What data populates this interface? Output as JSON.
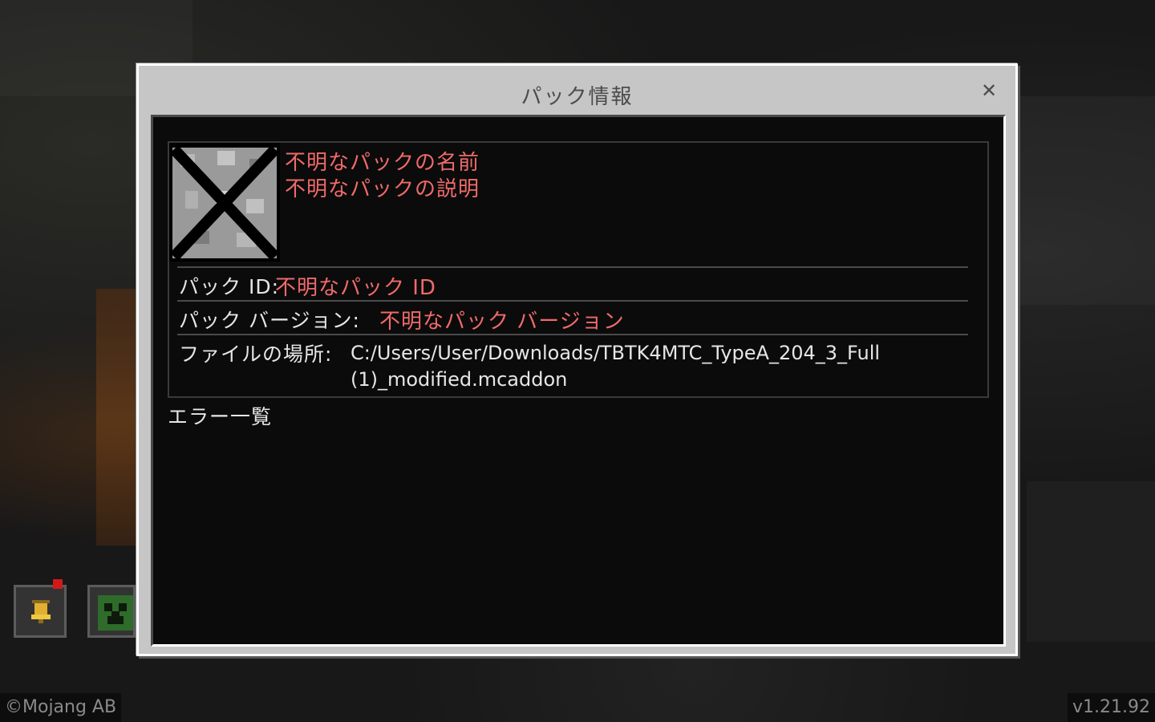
{
  "dialog": {
    "title": "パック情報",
    "close_symbol": "✕"
  },
  "pack": {
    "icon": "missing-texture-icon",
    "name": "不明なパックの名前",
    "description": "不明なパックの説明",
    "id_label": "パック ID:",
    "id_value": "不明なパック ID",
    "version_label": "パック バージョン:",
    "version_value": "不明なパック バージョン",
    "location_label": "ファイルの場所:",
    "location_line1": "C:/Users/User/Downloads/TBTK4MTC_TypeA_204_3_Full",
    "location_line2": "(1)_modified.mcaddon"
  },
  "errors": {
    "heading": "エラー一覧"
  },
  "footer": {
    "copyright": "©Mojang AB",
    "version": "v1.21.92"
  },
  "colors": {
    "error_text": "#f06a6a",
    "dialog_bg": "#c6c6c6",
    "content_bg": "#0b0b0b",
    "notification": "#d01a1a"
  }
}
